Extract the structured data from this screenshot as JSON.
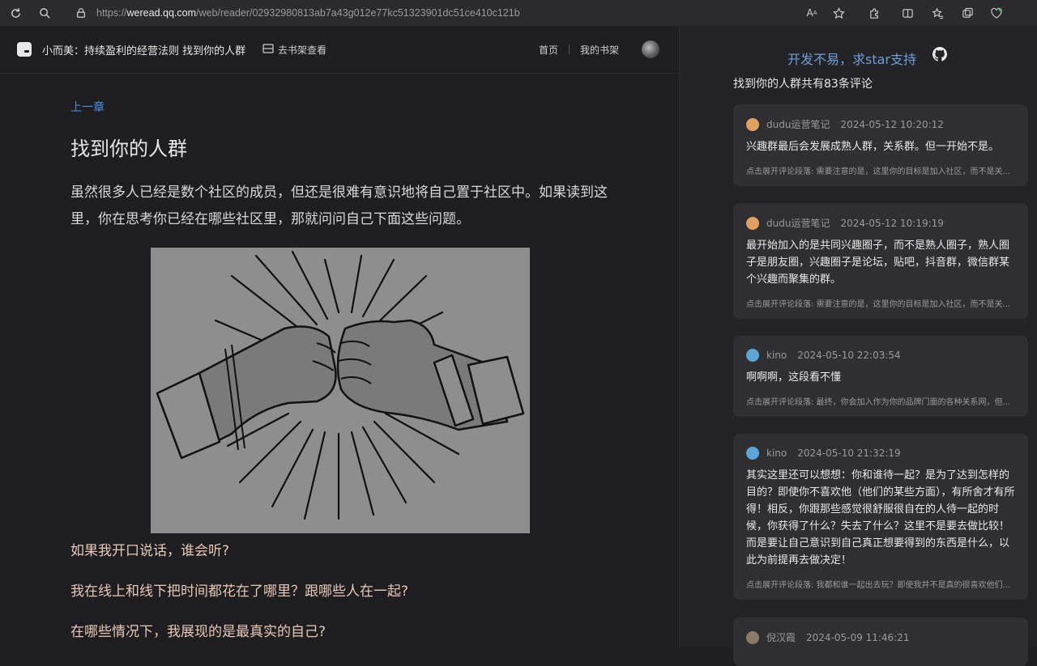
{
  "browser": {
    "url_prefix": "https://",
    "url_host": "weread.qq.com",
    "url_path": "/web/reader/02932980813ab7a43g012e77kc51323901dc51ce410c121b"
  },
  "header": {
    "book_title": "小而美：持续盈利的经营法则 找到你的人群",
    "shelf_button": "去书架查看",
    "nav_home": "首页",
    "nav_shelf": "我的书架"
  },
  "reader": {
    "prev_chapter": "上一章",
    "chapter_title": "找到你的人群",
    "paragraph": "虽然很多人已经是数个社区的成员，但还是很难有意识地将自己置于社区中。如果读到这里，你在思考你已经在哪些社区里，那就问问自己下面这些问题。",
    "questions": [
      "如果我开口说话，谁会听?",
      "我在线上和线下把时间都花在了哪里？跟哪些人在一起?",
      "在哪些情况下，我展现的是最真实的自己?"
    ]
  },
  "panel": {
    "star_message": "开发不易，求star支持",
    "comment_count": "找到你的人群共有83条评论",
    "comments": [
      {
        "user": "dudu运营笔记",
        "time": "2024-05-12 10:20:12",
        "text": "兴趣群最后会发展成熟人群，关系群。但一开始不是。",
        "ref": "点击展开评论段落: 需要注意的是，这里你的目标是加入社区，而不是关...",
        "avatar_color": "#e0a060"
      },
      {
        "user": "dudu运营笔记",
        "time": "2024-05-12 10:19:19",
        "text": "最开始加入的是共同兴趣圈子，而不是熟人圈子，熟人圈子是朋友圈，兴趣圈子是论坛，贴吧，抖音群，微信群某个兴趣而聚集的群。",
        "ref": "点击展开评论段落: 需要注意的是，这里你的目标是加入社区，而不是关...",
        "avatar_color": "#e0a060"
      },
      {
        "user": "kino",
        "time": "2024-05-10 22:03:54",
        "text": "啊啊啊，这段看不懂",
        "ref": "点击展开评论段落: 最终，你会加入作为你的品牌门面的各种关系网，但...",
        "avatar_color": "#5aa6d8"
      },
      {
        "user": "kino",
        "time": "2024-05-10 21:32:19",
        "text": "其实这里还可以想想：你和谁待一起？是为了达到怎样的目的？即使你不喜欢他（他们的某些方面），有所舍才有所得！相反，你跟那些感觉很舒服很自在的人待一起的时候，你获得了什么？失去了什么？这里不是要去做比较！而是要让自己意识到自己真正想要得到的东西是什么，以此为前提再去做决定！",
        "ref": "点击展开评论段落: 我都和谁一起出去玩？即使我并不是真的很喜欢他们...",
        "avatar_color": "#5aa6d8"
      },
      {
        "user": "倪汉霞",
        "time": "2024-05-09 11:46:21",
        "text": "",
        "ref": "",
        "avatar_color": "#8a7a6a"
      }
    ]
  }
}
